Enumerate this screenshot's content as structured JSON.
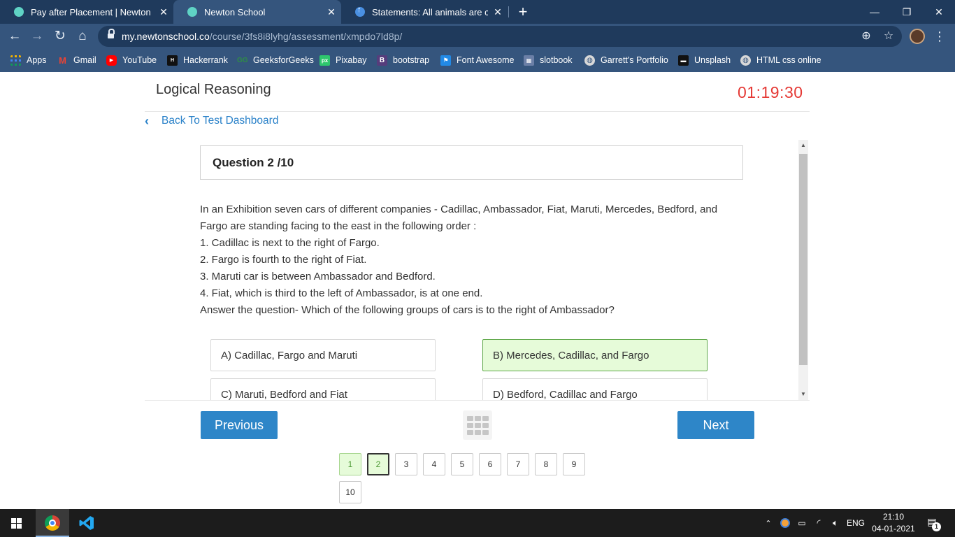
{
  "browser": {
    "tabs": [
      {
        "title": "Pay after Placement | Newton Sch",
        "active": false
      },
      {
        "title": "Newton School",
        "active": true
      },
      {
        "title": "Statements: All animals are cats. S",
        "active": false
      }
    ],
    "url_host": "my.newtonschool.co",
    "url_path": "/course/3fs8i8lyhg/assessment/xmpdo7ld8p/",
    "bookmarks": [
      {
        "label": "Apps",
        "icon": "apps-grid-icon",
        "color": "#ea4335"
      },
      {
        "label": "Gmail",
        "icon": "gmail-icon",
        "color": "#ea4335"
      },
      {
        "label": "YouTube",
        "icon": "youtube-icon",
        "color": "#ff0000"
      },
      {
        "label": "Hackerrank",
        "icon": "hackerrank-icon",
        "color": "#111111"
      },
      {
        "label": "GeeksforGeeks",
        "icon": "geeksforgeeks-icon",
        "color": "#2f8d46"
      },
      {
        "label": "Pixabay",
        "icon": "pixabay-icon",
        "color": "#2ec66d"
      },
      {
        "label": "bootstrap",
        "icon": "bootstrap-icon",
        "color": "#563d7c"
      },
      {
        "label": "Font Awesome",
        "icon": "font-awesome-icon",
        "color": "#228ae6"
      },
      {
        "label": "slotbook",
        "icon": "slotbook-icon",
        "color": "#6b7fa6"
      },
      {
        "label": "Garrett's Portfolio",
        "icon": "globe-icon",
        "color": "#d8d8d8"
      },
      {
        "label": "Unsplash",
        "icon": "unsplash-icon",
        "color": "#111111"
      },
      {
        "label": "HTML css online",
        "icon": "globe-icon",
        "color": "#d8d8d8"
      }
    ]
  },
  "page": {
    "section_title": "Logical Reasoning",
    "timer": "01:19:30",
    "back_link": "Back To Test Dashboard",
    "question_header": "Question 2 /10",
    "question_lines": [
      "In an Exhibition seven cars of different companies - Cadillac, Ambassador, Fiat, Maruti, Mercedes, Bedford, and",
      "Fargo are standing facing to the east in the following order :",
      "1. Cadillac is next to the right of Fargo.",
      "2. Fargo is fourth to the right of Fiat.",
      "3. Maruti car is between Ambassador and Bedford.",
      "4. Fiat, which is third to the left of Ambassador, is at one end.",
      "Answer the question- Which of the following groups of cars is to the right of Ambassador?"
    ],
    "options": [
      {
        "label": "A) Cadillac, Fargo and Maruti",
        "selected": false
      },
      {
        "label": "B) Mercedes, Cadillac, and Fargo",
        "selected": true
      },
      {
        "label": "C) Maruti, Bedford and Fiat",
        "selected": false
      },
      {
        "label": "D) Bedford, Cadillac and Fargo",
        "selected": false
      }
    ],
    "previous_label": "Previous",
    "next_label": "Next",
    "question_numbers": [
      {
        "n": "1",
        "state": "done"
      },
      {
        "n": "2",
        "state": "current"
      },
      {
        "n": "3",
        "state": "open"
      },
      {
        "n": "4",
        "state": "open"
      },
      {
        "n": "5",
        "state": "open"
      },
      {
        "n": "6",
        "state": "open"
      },
      {
        "n": "7",
        "state": "open"
      },
      {
        "n": "8",
        "state": "open"
      },
      {
        "n": "9",
        "state": "open"
      },
      {
        "n": "10",
        "state": "open"
      }
    ],
    "colors": {
      "accent": "#2e86c8",
      "timer": "#e53935",
      "selected_bg": "#e6fbd9"
    }
  },
  "taskbar": {
    "language": "ENG",
    "time": "21:10",
    "date": "04-01-2021",
    "notification_count": "1"
  }
}
